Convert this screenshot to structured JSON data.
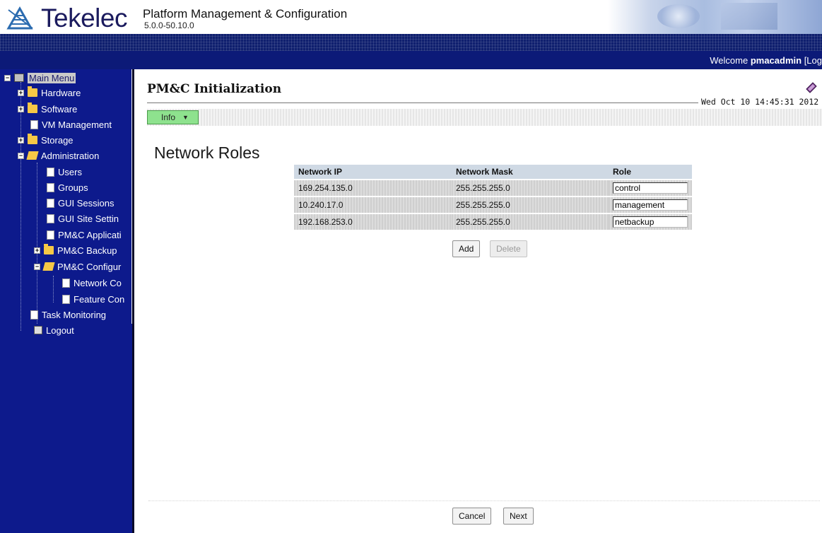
{
  "header": {
    "brand": "Tekelec",
    "app_title": "Platform Management & Configuration",
    "app_version": "5.0.0-50.10.0",
    "welcome_prefix": "Welcome ",
    "username": "pmacadmin",
    "welcome_suffix": " [Log"
  },
  "sidebar": {
    "main_menu": "Main Menu",
    "hardware": "Hardware",
    "software": "Software",
    "vm_management": "VM Management",
    "storage": "Storage",
    "administration": "Administration",
    "users": "Users",
    "groups": "Groups",
    "gui_sessions": "GUI Sessions",
    "gui_site_settings": "GUI Site Settin",
    "pmac_application": "PM&C Applicati",
    "pmac_backup": "PM&C Backup",
    "pmac_configuration": "PM&C Configur",
    "network_config": "Network Co",
    "feature_config": "Feature Con",
    "task_monitoring": "Task Monitoring",
    "logout": "Logout"
  },
  "page": {
    "title": "PM&C Initialization",
    "timestamp": "Wed Oct 10 14:45:31 2012",
    "info_label": "Info",
    "section_title": "Network Roles"
  },
  "table": {
    "headers": [
      "Network IP",
      "Network Mask",
      "Role"
    ],
    "rows": [
      {
        "ip": "169.254.135.0",
        "mask": "255.255.255.0",
        "role": "control"
      },
      {
        "ip": "10.240.17.0",
        "mask": "255.255.255.0",
        "role": "management"
      },
      {
        "ip": "192.168.253.0",
        "mask": "255.255.255.0",
        "role": "netbackup"
      }
    ]
  },
  "buttons": {
    "add": "Add",
    "delete": "Delete",
    "cancel": "Cancel",
    "next": "Next"
  },
  "colors": {
    "sidebar_bg": "#0d1a8c",
    "welcome_bar": "#0c1a78",
    "info_green": "#8ee28e",
    "table_header": "#cfd9e4"
  },
  "icons": {
    "logo": "tekelec-logo-icon",
    "help": "help-book-icon",
    "folder": "folder-icon",
    "document": "document-icon"
  }
}
